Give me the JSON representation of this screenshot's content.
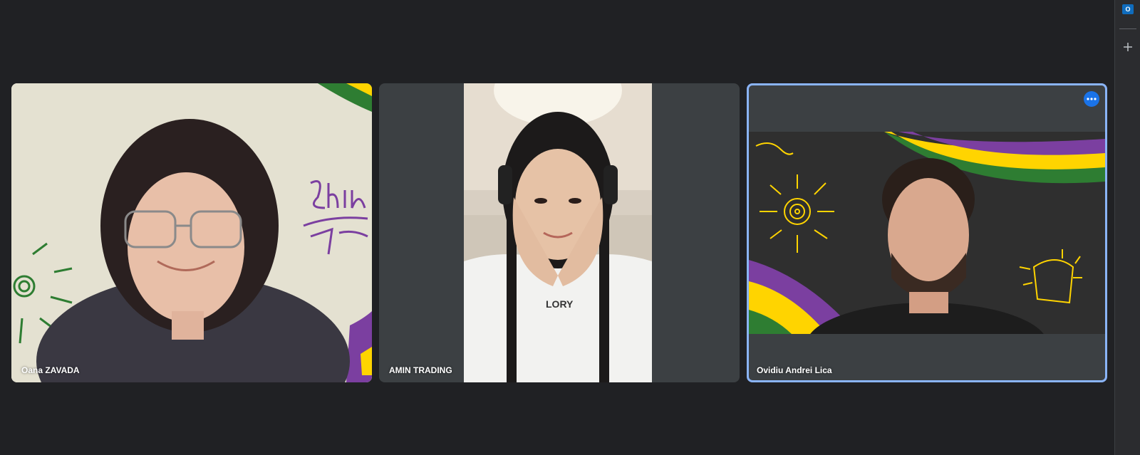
{
  "participants": [
    {
      "name": "Oana ZAVADA",
      "active": false,
      "tile_bg_color": "#e6e3d4"
    },
    {
      "name": "AMIN TRADING",
      "active": false,
      "tile_bg_color": "#e9e2d6"
    },
    {
      "name": "Ovidiu Andrei Lica",
      "active": true,
      "tile_bg_color": "#2d2d2d"
    }
  ],
  "colors": {
    "background": "#202124",
    "tile": "#3c4043",
    "active_border": "#8ab4f8",
    "accent": "#1a73e8",
    "brand_purple": "#7b3fa0",
    "brand_yellow": "#ffd400",
    "brand_green": "#2e7d32"
  },
  "icons": {
    "more_options": "more-horiz-icon",
    "outlook": "outlook-icon",
    "add": "plus-icon"
  }
}
